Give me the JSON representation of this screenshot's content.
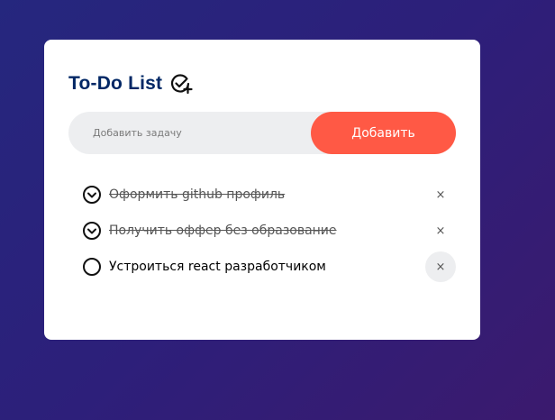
{
  "app": {
    "title": "To-Do List",
    "accent_color": "#ff5945",
    "title_color": "#002765"
  },
  "input": {
    "placeholder": "Добавить задачу",
    "value": "",
    "button_label": "Добавить"
  },
  "tasks": [
    {
      "text": "Оформить github профиль",
      "done": true,
      "delete_label": "×"
    },
    {
      "text": "Получить оффер без образование",
      "done": true,
      "delete_label": "×"
    },
    {
      "text": "Устроиться react разработчиком",
      "done": false,
      "delete_label": "×"
    }
  ]
}
